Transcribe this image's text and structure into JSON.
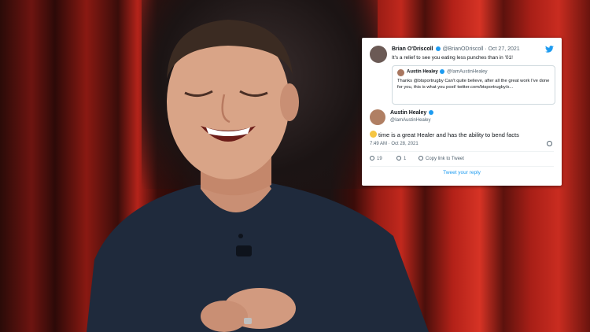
{
  "colors": {
    "curtain_red": "#c1281d",
    "backdrop_dark": "#1c1212",
    "shirt_navy": "#1f2a3c",
    "skin": "#d9a487",
    "twitter_blue": "#1d9bf0"
  },
  "tweet": {
    "author_name": "Brian O'Driscoll",
    "author_handle": "@BrianODriscoll · Oct 27, 2021",
    "text": "It's a relief to see you eating less punches than in '01!",
    "icon": "twitter-bird-icon",
    "quoted": {
      "author_name": "Austin Healey",
      "author_handle": "@IamAustinHealey",
      "text": "Thanks @btsportrugby Can't quite believe, after all the great work I've done for you, this is what you post! twitter.com/btsportrugby/s..."
    }
  },
  "reply": {
    "author_name": "Austin Healey",
    "author_handle": "@IamAustinHealey",
    "emoji": "laughing-crying-emoji",
    "text": "time is a great Healer and  has the ability to bend facts",
    "timestamp": "7:49 AM · Oct 28, 2021",
    "likes": "19",
    "replies": "1",
    "copy_link_label": "Copy link to Tweet",
    "tweet_reply_label": "Tweet your reply"
  }
}
